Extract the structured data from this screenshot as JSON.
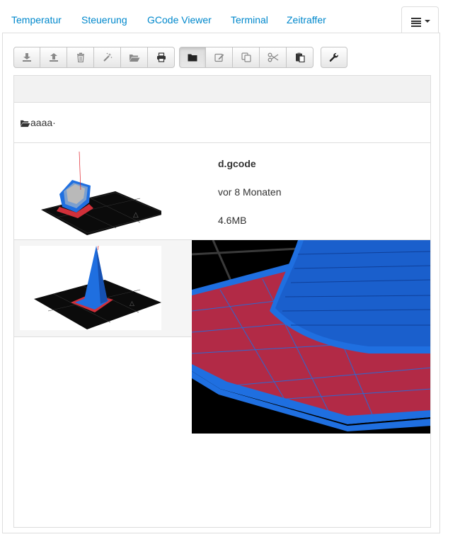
{
  "tabs": [
    {
      "label": "Temperatur"
    },
    {
      "label": "Steuerung"
    },
    {
      "label": "GCode Viewer"
    },
    {
      "label": "Terminal"
    },
    {
      "label": "Zeitraffer"
    }
  ],
  "toolbar": {
    "group1": [
      "download-icon",
      "upload-icon",
      "trash-icon",
      "magic-wand-icon",
      "folder-open-icon",
      "print-icon"
    ],
    "group2": [
      "folder-icon",
      "edit-icon",
      "copy-icon",
      "cut-icon",
      "paste-icon"
    ],
    "group3": [
      "wrench-icon"
    ]
  },
  "browser": {
    "folder": {
      "name": "aaaa·"
    },
    "file": {
      "name": "d.gcode",
      "date": "vor 8 Monaten",
      "size": "4.6MB"
    }
  },
  "colors": {
    "link": "#0088cc",
    "model_blue": "#1f6fe0",
    "print_red": "#e0202a"
  }
}
